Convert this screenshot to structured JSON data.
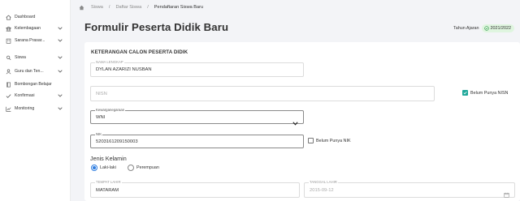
{
  "sidebar": {
    "items": [
      {
        "label": "Dashboard",
        "icon": "home-icon"
      },
      {
        "label": "Kelembagaan",
        "icon": "institution-icon",
        "expandable": true
      },
      {
        "label": "Sarana Prasar...",
        "icon": "building-icon",
        "expandable": true
      },
      {
        "label": "Siswa",
        "icon": "students-icon",
        "expandable": true
      },
      {
        "label": "Guru dan Ten...",
        "icon": "teacher-icon",
        "expandable": true
      },
      {
        "label": "Bombongan Belajar",
        "icon": "book-icon"
      },
      {
        "label": "Konfirmasi",
        "icon": "check-icon",
        "expandable": true
      },
      {
        "label": "Monitoring",
        "icon": "chart-icon",
        "expandable": true
      }
    ]
  },
  "breadcrumb": {
    "items": [
      "Siswa",
      "Daftar Siswa",
      "Pendaftaran Siswa Baru"
    ]
  },
  "page": {
    "title": "Formulir Peserta Didik Baru",
    "year_label": "Tahun Ajaran",
    "year_value": "2021/2022"
  },
  "form": {
    "section_title": "KETERANGAN CALON PESERTA DIDIK",
    "nama": {
      "label": "NAMA LENGKAP",
      "value": "DYLAN AZARIZI NUSBAN"
    },
    "nisn": {
      "placeholder": "NISN"
    },
    "belum_nisn": {
      "label": "Belum Punya NISN",
      "checked": true
    },
    "kewarganegaraan": {
      "label": "Kewarganegaraan",
      "value": "WNI"
    },
    "nik": {
      "label": "NIK",
      "value": "5203161209150003"
    },
    "belum_nik": {
      "label": "Belum Punya NIK",
      "checked": false
    },
    "jenis_kelamin": {
      "label": "Jenis Kelamin",
      "options": [
        "Laki-laki",
        "Perempuan"
      ],
      "selected": "Laki-laki"
    },
    "tempat_lahir": {
      "label": "TEMPAT LAHIR",
      "value": "MATARAM"
    },
    "tanggal_lahir": {
      "label": "TANGGAL LAHIR",
      "value": "2015-09-12"
    }
  },
  "colors": {
    "accent_green": "#1fa89a",
    "radio_blue": "#2e7de0",
    "badge_bg": "#dff5df"
  }
}
